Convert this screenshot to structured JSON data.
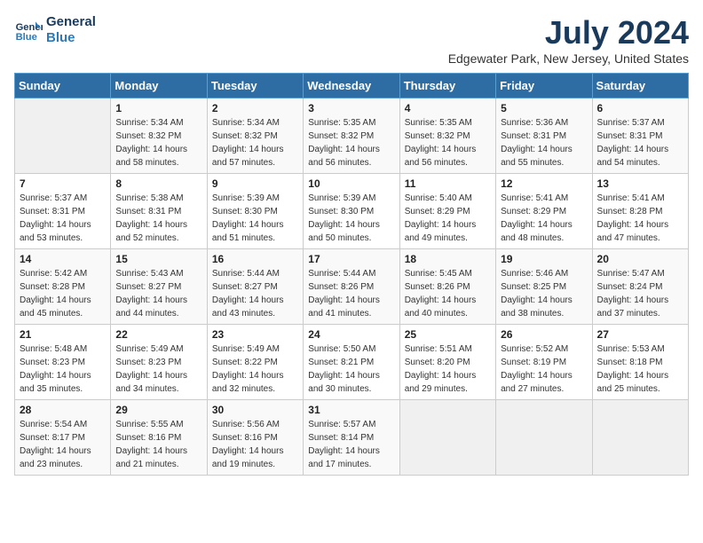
{
  "logo": {
    "line1": "General",
    "line2": "Blue"
  },
  "title": "July 2024",
  "location": "Edgewater Park, New Jersey, United States",
  "headers": [
    "Sunday",
    "Monday",
    "Tuesday",
    "Wednesday",
    "Thursday",
    "Friday",
    "Saturday"
  ],
  "weeks": [
    [
      {
        "day": "",
        "empty": true
      },
      {
        "day": "1",
        "sunrise": "5:34 AM",
        "sunset": "8:32 PM",
        "daylight": "14 hours and 58 minutes."
      },
      {
        "day": "2",
        "sunrise": "5:34 AM",
        "sunset": "8:32 PM",
        "daylight": "14 hours and 57 minutes."
      },
      {
        "day": "3",
        "sunrise": "5:35 AM",
        "sunset": "8:32 PM",
        "daylight": "14 hours and 56 minutes."
      },
      {
        "day": "4",
        "sunrise": "5:35 AM",
        "sunset": "8:32 PM",
        "daylight": "14 hours and 56 minutes."
      },
      {
        "day": "5",
        "sunrise": "5:36 AM",
        "sunset": "8:31 PM",
        "daylight": "14 hours and 55 minutes."
      },
      {
        "day": "6",
        "sunrise": "5:37 AM",
        "sunset": "8:31 PM",
        "daylight": "14 hours and 54 minutes."
      }
    ],
    [
      {
        "day": "7",
        "sunrise": "5:37 AM",
        "sunset": "8:31 PM",
        "daylight": "14 hours and 53 minutes."
      },
      {
        "day": "8",
        "sunrise": "5:38 AM",
        "sunset": "8:31 PM",
        "daylight": "14 hours and 52 minutes."
      },
      {
        "day": "9",
        "sunrise": "5:39 AM",
        "sunset": "8:30 PM",
        "daylight": "14 hours and 51 minutes."
      },
      {
        "day": "10",
        "sunrise": "5:39 AM",
        "sunset": "8:30 PM",
        "daylight": "14 hours and 50 minutes."
      },
      {
        "day": "11",
        "sunrise": "5:40 AM",
        "sunset": "8:29 PM",
        "daylight": "14 hours and 49 minutes."
      },
      {
        "day": "12",
        "sunrise": "5:41 AM",
        "sunset": "8:29 PM",
        "daylight": "14 hours and 48 minutes."
      },
      {
        "day": "13",
        "sunrise": "5:41 AM",
        "sunset": "8:28 PM",
        "daylight": "14 hours and 47 minutes."
      }
    ],
    [
      {
        "day": "14",
        "sunrise": "5:42 AM",
        "sunset": "8:28 PM",
        "daylight": "14 hours and 45 minutes."
      },
      {
        "day": "15",
        "sunrise": "5:43 AM",
        "sunset": "8:27 PM",
        "daylight": "14 hours and 44 minutes."
      },
      {
        "day": "16",
        "sunrise": "5:44 AM",
        "sunset": "8:27 PM",
        "daylight": "14 hours and 43 minutes."
      },
      {
        "day": "17",
        "sunrise": "5:44 AM",
        "sunset": "8:26 PM",
        "daylight": "14 hours and 41 minutes."
      },
      {
        "day": "18",
        "sunrise": "5:45 AM",
        "sunset": "8:26 PM",
        "daylight": "14 hours and 40 minutes."
      },
      {
        "day": "19",
        "sunrise": "5:46 AM",
        "sunset": "8:25 PM",
        "daylight": "14 hours and 38 minutes."
      },
      {
        "day": "20",
        "sunrise": "5:47 AM",
        "sunset": "8:24 PM",
        "daylight": "14 hours and 37 minutes."
      }
    ],
    [
      {
        "day": "21",
        "sunrise": "5:48 AM",
        "sunset": "8:23 PM",
        "daylight": "14 hours and 35 minutes."
      },
      {
        "day": "22",
        "sunrise": "5:49 AM",
        "sunset": "8:23 PM",
        "daylight": "14 hours and 34 minutes."
      },
      {
        "day": "23",
        "sunrise": "5:49 AM",
        "sunset": "8:22 PM",
        "daylight": "14 hours and 32 minutes."
      },
      {
        "day": "24",
        "sunrise": "5:50 AM",
        "sunset": "8:21 PM",
        "daylight": "14 hours and 30 minutes."
      },
      {
        "day": "25",
        "sunrise": "5:51 AM",
        "sunset": "8:20 PM",
        "daylight": "14 hours and 29 minutes."
      },
      {
        "day": "26",
        "sunrise": "5:52 AM",
        "sunset": "8:19 PM",
        "daylight": "14 hours and 27 minutes."
      },
      {
        "day": "27",
        "sunrise": "5:53 AM",
        "sunset": "8:18 PM",
        "daylight": "14 hours and 25 minutes."
      }
    ],
    [
      {
        "day": "28",
        "sunrise": "5:54 AM",
        "sunset": "8:17 PM",
        "daylight": "14 hours and 23 minutes."
      },
      {
        "day": "29",
        "sunrise": "5:55 AM",
        "sunset": "8:16 PM",
        "daylight": "14 hours and 21 minutes."
      },
      {
        "day": "30",
        "sunrise": "5:56 AM",
        "sunset": "8:16 PM",
        "daylight": "14 hours and 19 minutes."
      },
      {
        "day": "31",
        "sunrise": "5:57 AM",
        "sunset": "8:14 PM",
        "daylight": "14 hours and 17 minutes."
      },
      {
        "day": "",
        "empty": true
      },
      {
        "day": "",
        "empty": true
      },
      {
        "day": "",
        "empty": true
      }
    ]
  ],
  "labels": {
    "sunrise_prefix": "Sunrise: ",
    "sunset_prefix": "Sunset: ",
    "daylight_prefix": "Daylight: "
  }
}
